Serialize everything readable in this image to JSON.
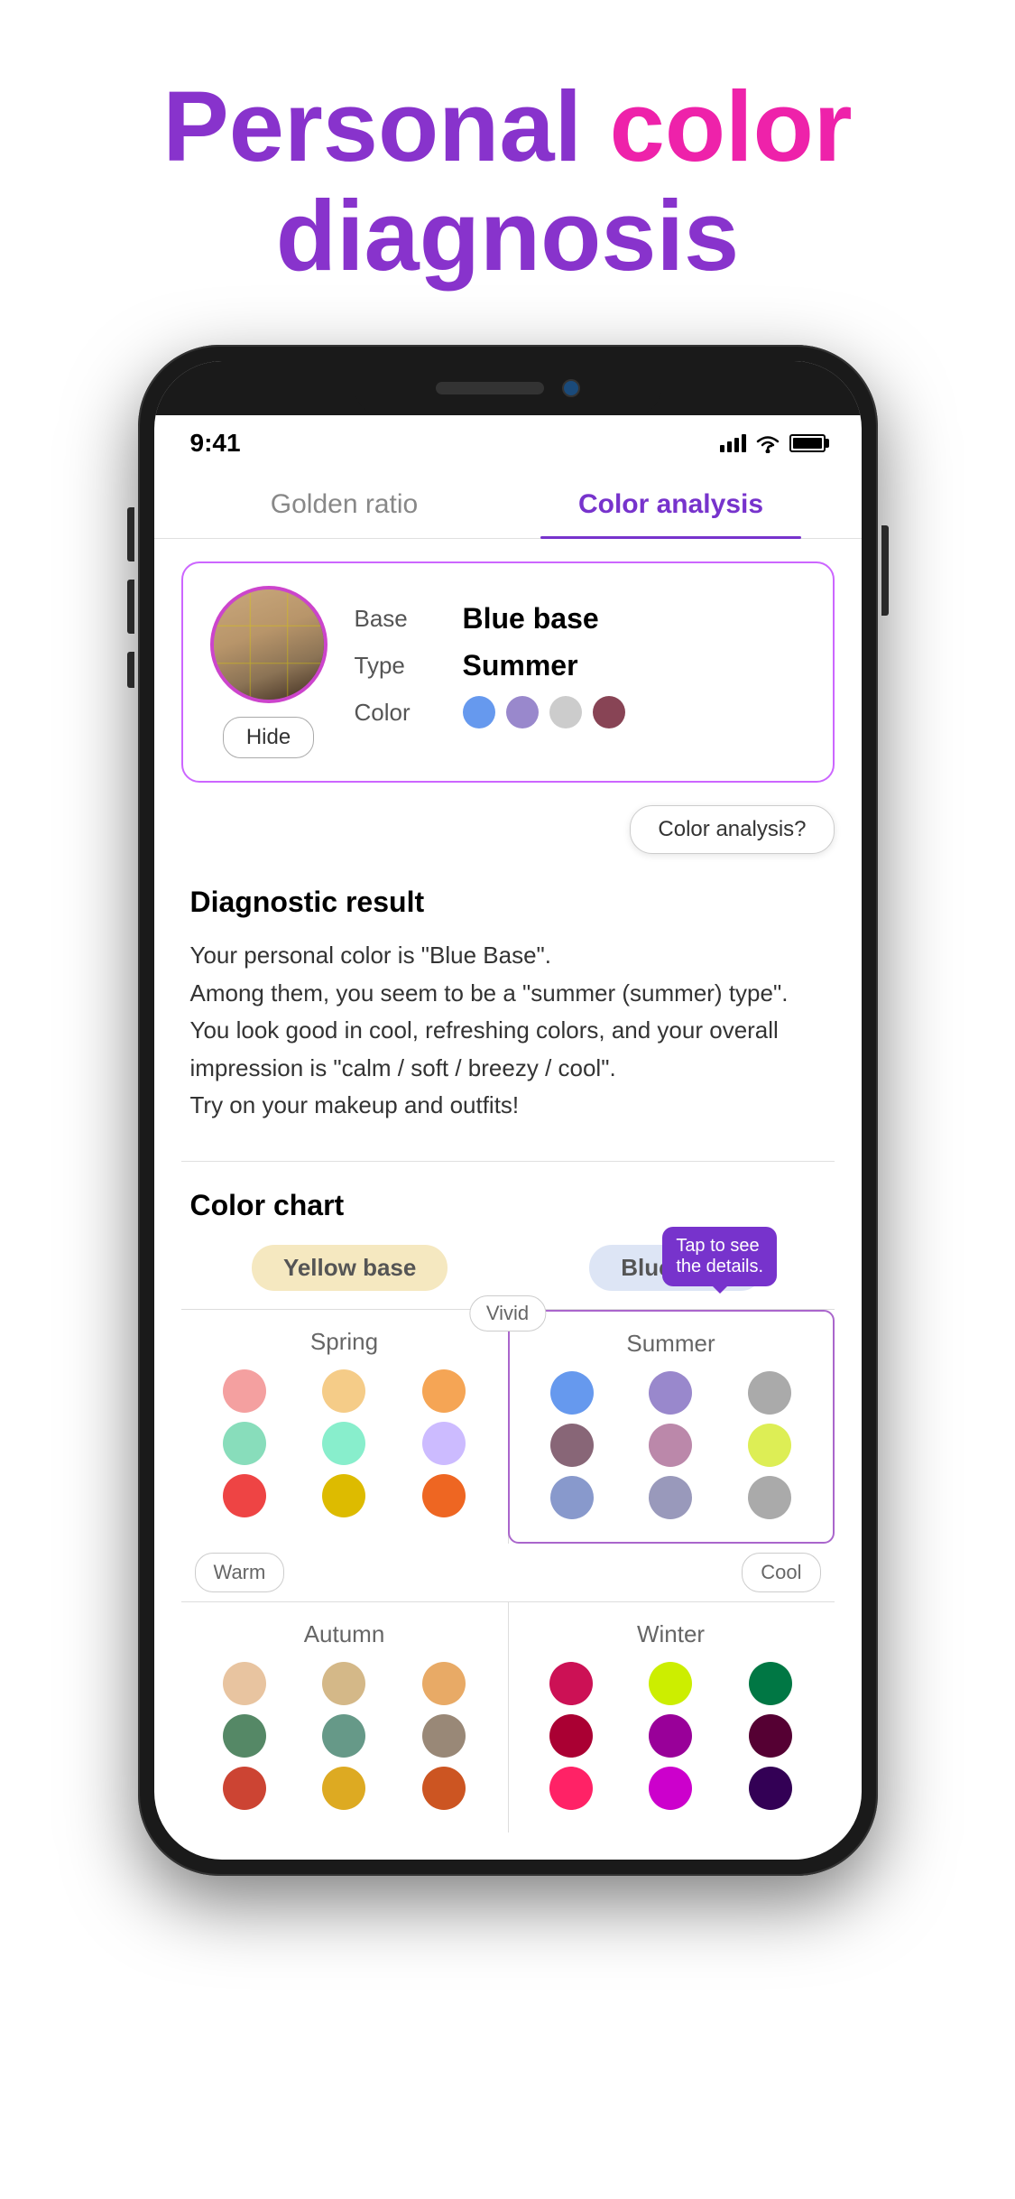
{
  "header": {
    "title_personal": "Personal ",
    "title_color": "color",
    "title_diagnosis": "diagnosis"
  },
  "status_bar": {
    "time": "9:41",
    "signal": "●●●●",
    "wifi": "WiFi",
    "battery": "100%"
  },
  "tabs": [
    {
      "id": "golden-ratio",
      "label": "Golden ratio",
      "active": false
    },
    {
      "id": "color-analysis",
      "label": "Color analysis",
      "active": true
    }
  ],
  "profile_card": {
    "base_label": "Base",
    "base_value": "Blue base",
    "type_label": "Type",
    "type_value": "Summer",
    "color_label": "Color",
    "hide_button": "Hide",
    "colors": [
      {
        "id": "c1",
        "hex": "#6699ee"
      },
      {
        "id": "c2",
        "hex": "#9988cc"
      },
      {
        "id": "c3",
        "hex": "#cccccc"
      },
      {
        "id": "c4",
        "hex": "#884455"
      }
    ]
  },
  "color_analysis_button": "Color analysis?",
  "diagnostic": {
    "title": "Diagnostic result",
    "text": "Your personal color is \"Blue Base\".\nAmong them, you seem to be a \"summer (summer) type\".\nYou look good in cool, refreshing colors, and your overall impression is \"calm / soft / breezy / cool\".\nTry on your makeup and outfits!"
  },
  "color_chart": {
    "title": "Color chart",
    "yellow_base_label": "Yellow base",
    "blue_base_label": "Blue base",
    "vivid_label": "Vivid",
    "warm_label": "Warm",
    "cool_label": "Cool",
    "tap_tooltip": "Tap to see\nthe details.",
    "seasons": {
      "spring": {
        "name": "Spring",
        "dots": [
          "#f4a0a0",
          "#f5cc88",
          "#f5a555",
          "#88ddbb",
          "#88eecc",
          "#ccbbff",
          "#ee4444",
          "#ddbb00",
          "#ee6622"
        ]
      },
      "summer": {
        "name": "Summer",
        "highlighted": true,
        "dots": [
          "#6699ee",
          "#9988cc",
          "#aaaaaa",
          "#886677",
          "#bb88aa",
          "#ddee55",
          "#8899cc",
          "#9999bb",
          "#aaaaaa"
        ]
      },
      "autumn": {
        "name": "Autumn",
        "dots": [
          "#e8c4a0",
          "#d4b888",
          "#e8aa66",
          "#558866",
          "#669988",
          "#998877",
          "#cc4433",
          "#ddaa22",
          "#cc5522"
        ]
      },
      "winter": {
        "name": "Winter",
        "dots": [
          "#cc1155",
          "#ccee00",
          "#007744",
          "#aa0033",
          "#990099",
          "#550033",
          "#ff2266",
          "#cc00cc",
          "#330055"
        ]
      }
    }
  }
}
